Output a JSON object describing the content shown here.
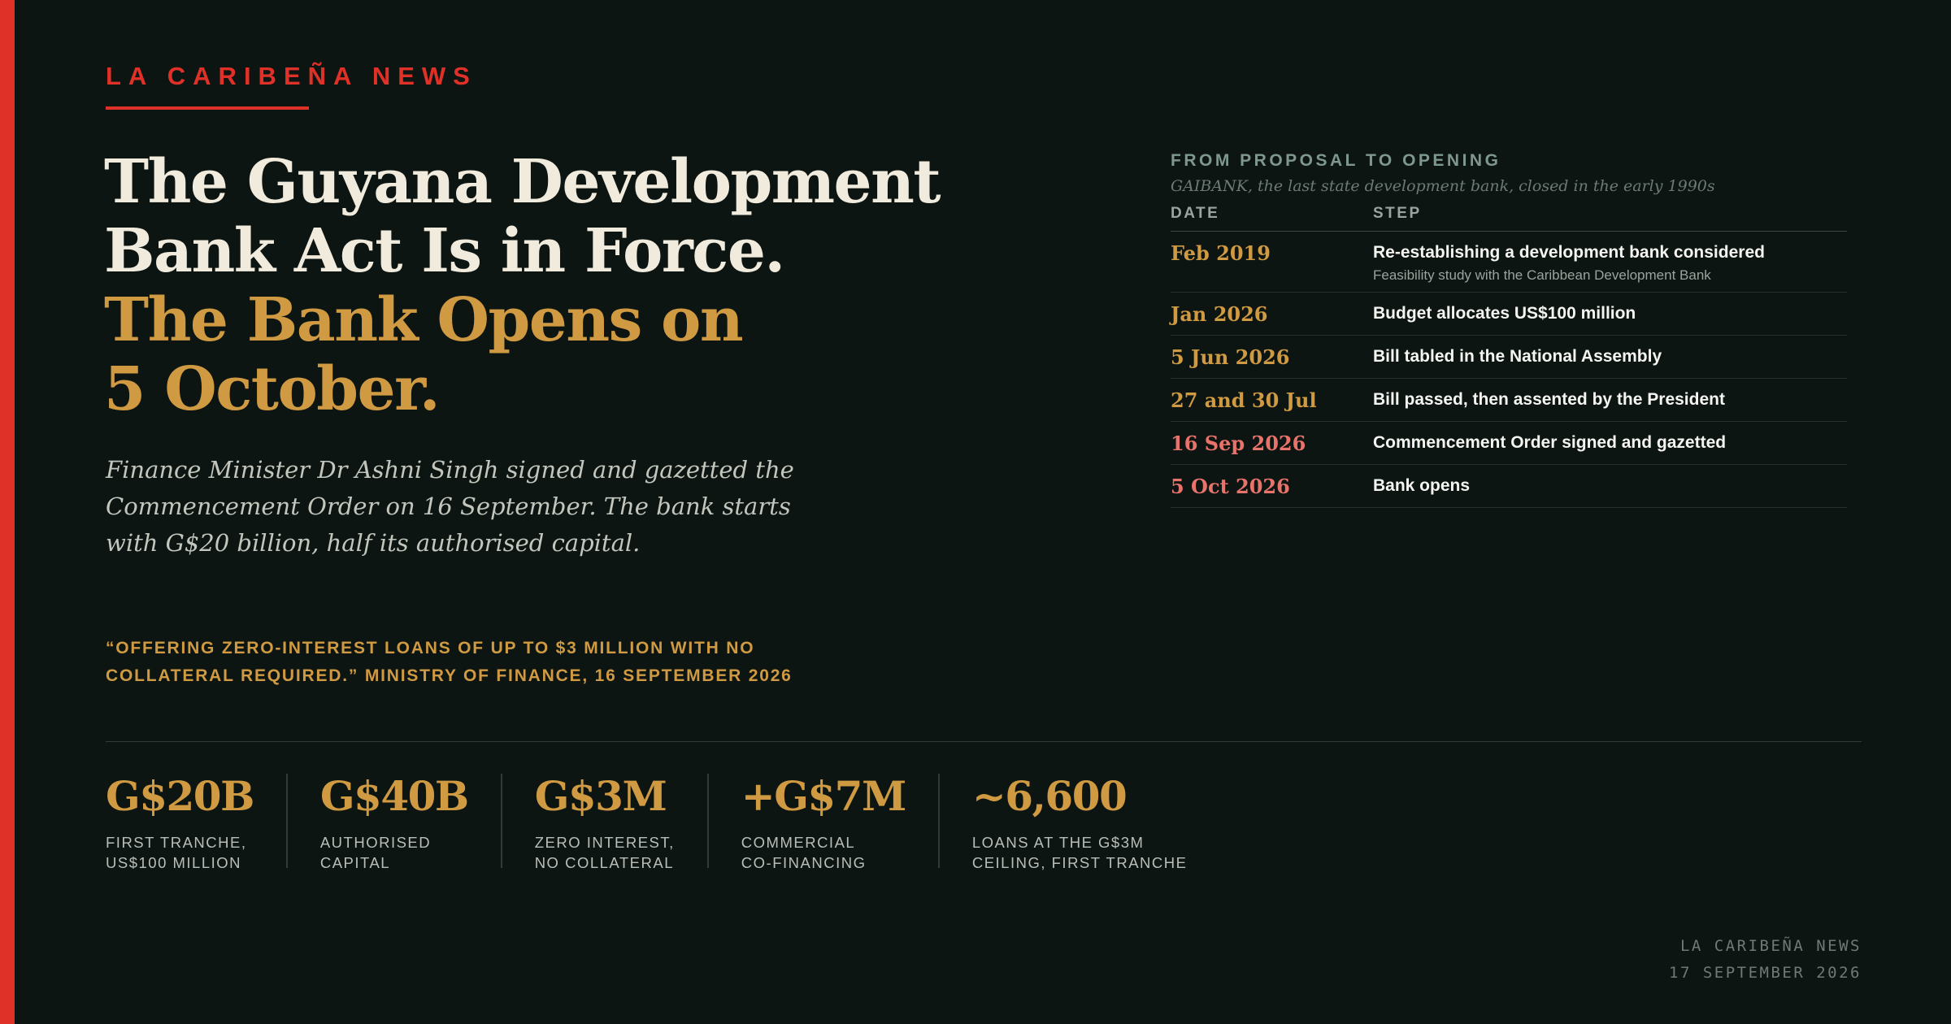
{
  "colors": {
    "background": "#0d1512",
    "accent_red": "#e03128",
    "accent_gold": "#cf9a42",
    "highlight_pink": "#e8736b",
    "headline_cream": "#f1ebdd"
  },
  "brand": {
    "name": "LA CARIBEÑA NEWS"
  },
  "headline": {
    "line1": "The Guyana Development",
    "line2": "Bank Act Is in Force.",
    "line3": "The Bank Opens on",
    "line4": "5 October."
  },
  "dek": "Finance Minister Dr Ashni Singh signed and gazetted the Commencement Order on 16 September. The bank starts with G$20 billion, half its authorised capital.",
  "quote": {
    "text": "“Offering zero-interest loans of up to $3 million with no collateral required.” Ministry of Finance, 16 September 2026"
  },
  "timeline": {
    "title": "FROM PROPOSAL TO OPENING",
    "subtitle": "GAIBANK, the last state development bank, closed in the early 1990s",
    "col_date": "DATE",
    "col_step": "STEP",
    "rows": [
      {
        "date": "Feb 2019",
        "step": "Re-establishing a development bank considered",
        "note": "Feasibility study with the Caribbean Development Bank"
      },
      {
        "date": "Jan 2026",
        "step": "Budget allocates US$100 million"
      },
      {
        "date": "5 Jun 2026",
        "step": "Bill tabled in the National Assembly"
      },
      {
        "date": "27 and 30 Jul",
        "step": "Bill passed, then assented by the President"
      },
      {
        "date": "16 Sep 2026",
        "step": "Commencement Order signed and gazetted"
      },
      {
        "date": "5 Oct 2026",
        "step": "Bank opens"
      }
    ]
  },
  "stats": [
    {
      "value": "G$20B",
      "label1": "First tranche,",
      "label2": "US$100 million"
    },
    {
      "value": "G$40B",
      "label1": "Authorised",
      "label2": "capital"
    },
    {
      "value": "G$3M",
      "label1": "Zero interest,",
      "label2": "no collateral"
    },
    {
      "value": "+G$7M",
      "label1": "Commercial",
      "label2": "co-financing"
    },
    {
      "value": "~6,600",
      "label1": "Loans at the G$3M",
      "label2": "ceiling, first tranche"
    }
  ],
  "footer": {
    "publication": "LA CARIBEÑA NEWS",
    "date": "17 SEPTEMBER 2026"
  }
}
